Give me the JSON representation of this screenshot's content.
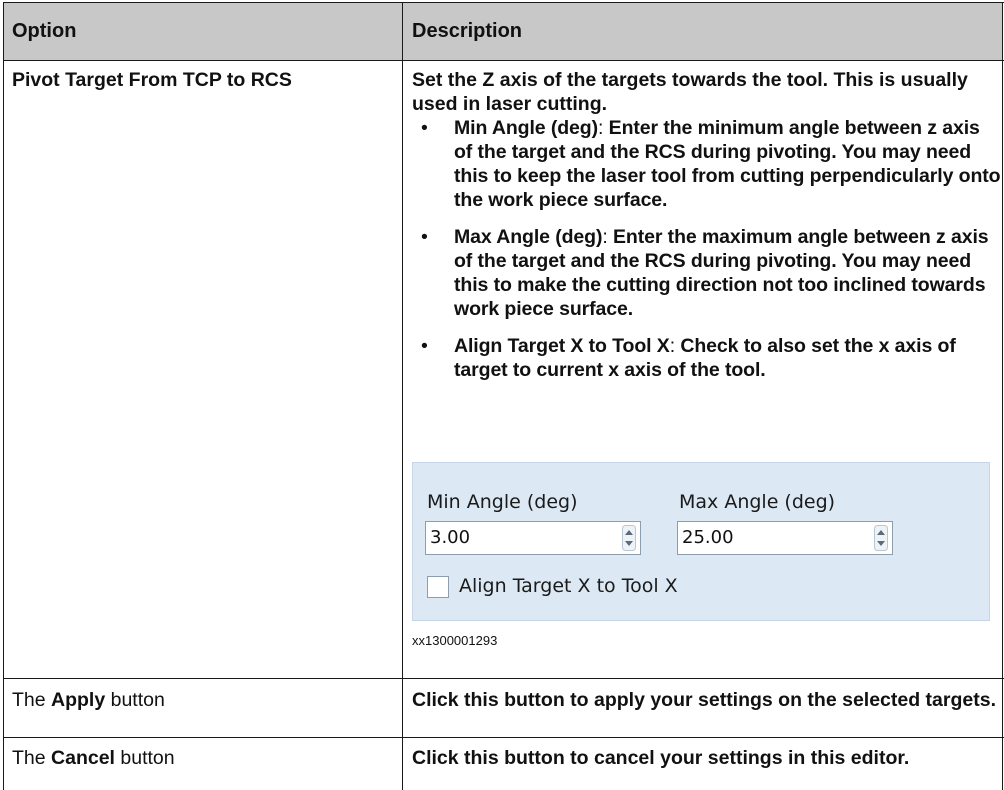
{
  "header": {
    "option": "Option",
    "description": "Description"
  },
  "row_pivot": {
    "option": "Pivot Target From TCP to RCS",
    "intro": "Set the Z axis of the targets towards the tool. This is usually used in laser cutting.",
    "bullets": [
      {
        "term": "Min Angle (deg)",
        "sep": ": ",
        "text": "Enter the minimum angle between z axis of the target and the RCS during pivoting. You may need this to keep the laser tool from cutting perpendicularly onto the work piece surface."
      },
      {
        "term": "Max Angle (deg)",
        "sep": ": ",
        "text": "Enter the maximum angle between z axis of the target and the RCS during pivoting. You may need this to make the cutting direction not too inclined towards work piece surface."
      },
      {
        "term": "Align Target X to Tool X",
        "sep": ": ",
        "text": "Check to also set the x axis of target to current x axis of the tool."
      }
    ],
    "dialog": {
      "min_label": "Min Angle (deg)",
      "min_value": "3.00",
      "max_label": "Max Angle (deg)",
      "max_value": "25.00",
      "checkbox_label": "Align Target X to Tool X",
      "checkbox_checked": false
    },
    "caption": "xx1300001293"
  },
  "row_apply": {
    "option_pre": "The ",
    "option_term": "Apply",
    "option_post": " button",
    "description": "Click this button to apply your settings on the selected targets."
  },
  "row_cancel": {
    "option_pre": "The ",
    "option_term": "Cancel",
    "option_post": " button",
    "description": "Click this button to cancel your settings in this editor."
  },
  "colors": {
    "header_bg": "#c8c8c8",
    "panel_bg": "#dce9f5",
    "border": "#1a1a1a"
  }
}
